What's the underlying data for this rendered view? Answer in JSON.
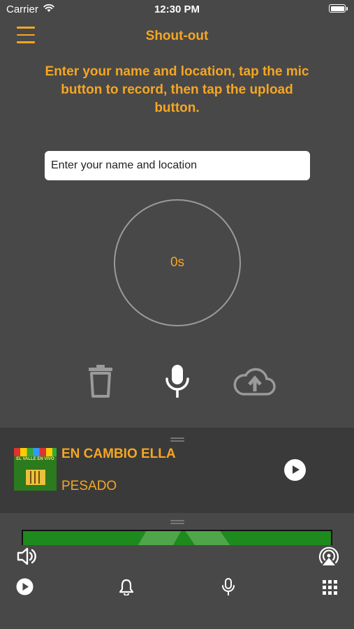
{
  "status_bar": {
    "carrier": "Carrier",
    "time": "12:30 PM"
  },
  "nav": {
    "title": "Shout-out",
    "menu_icon": "hamburger-menu-icon"
  },
  "instructions": "Enter your name and location, tap the mic button to record, then tap the upload button.",
  "name_input": {
    "placeholder": "Enter your name and location",
    "value": ""
  },
  "timer": {
    "text": "0s"
  },
  "controls": {
    "delete_icon": "trash-icon",
    "record_icon": "microphone-icon",
    "upload_icon": "cloud-upload-icon"
  },
  "now_playing": {
    "title": "EN CAMBIO ELLA",
    "artist": "PESADO",
    "album_art_text": "EL VALLE EN VIVO"
  },
  "bottom_bar": {
    "icons": [
      "play-circle-icon",
      "bell-icon",
      "microphone-icon",
      "grid-icon"
    ]
  },
  "colors": {
    "accent": "#f5a623",
    "background": "#484848",
    "panel": "#3a3a3a",
    "banner": "#1e8a1e"
  }
}
